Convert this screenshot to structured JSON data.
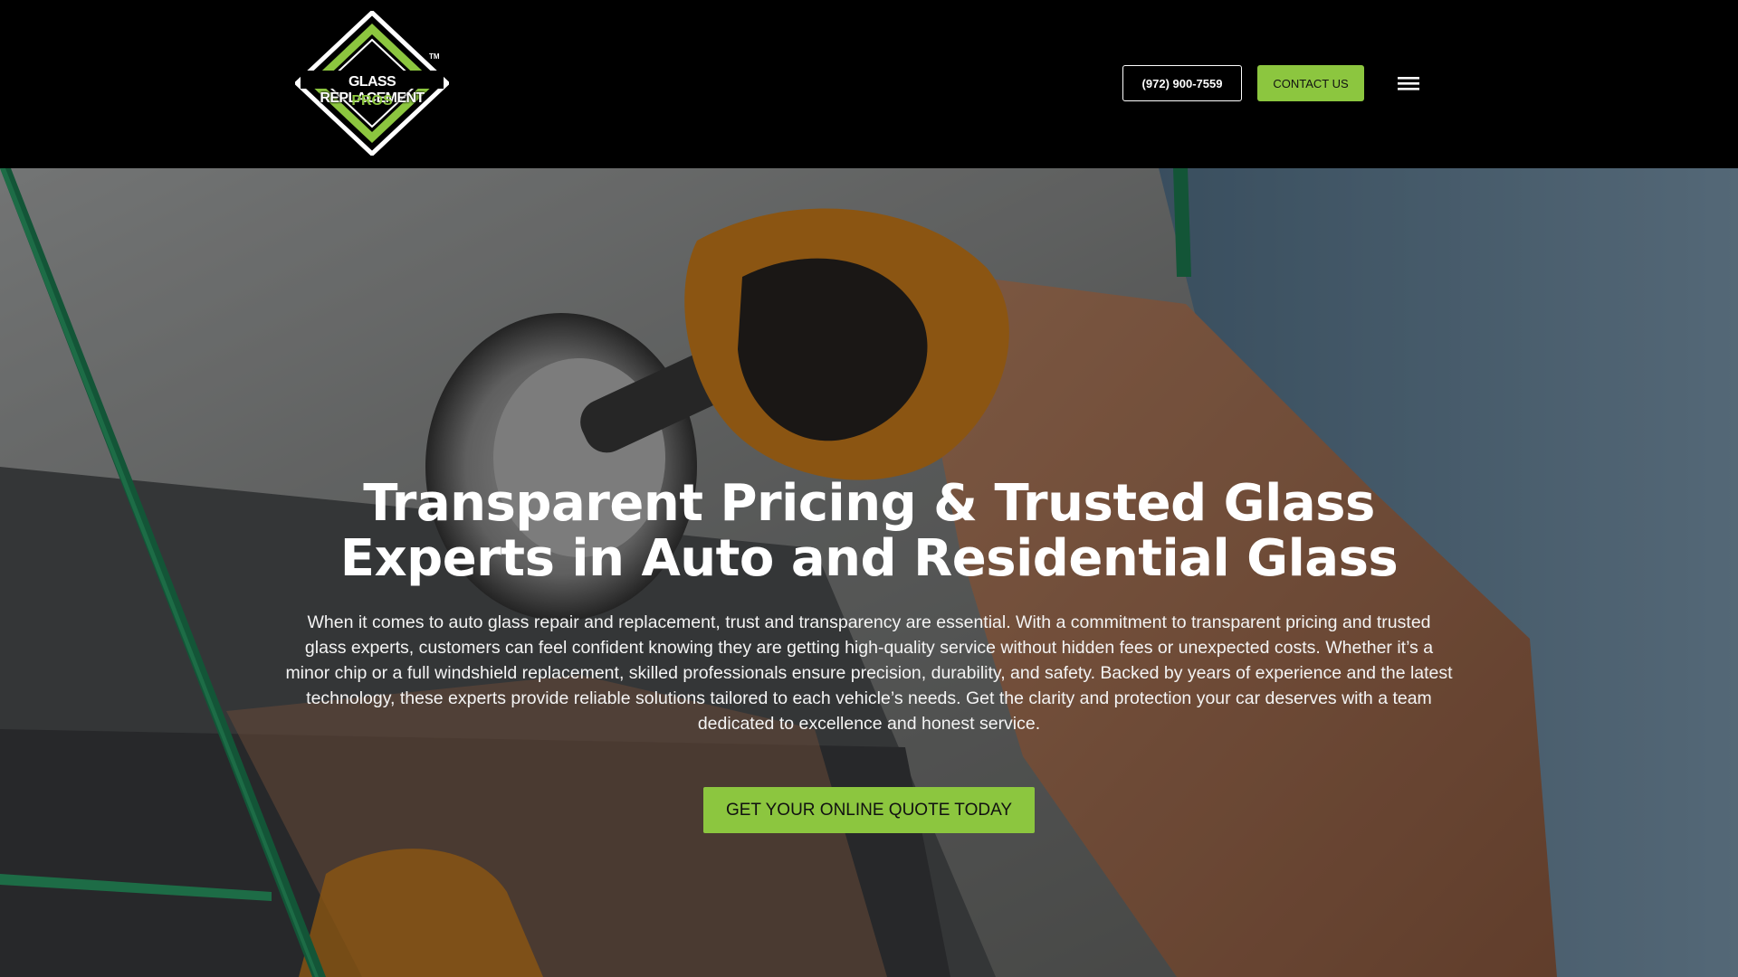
{
  "header": {
    "logo": {
      "line1": "GLASS REPLACEMENT",
      "line2": "PROS",
      "trademark": "TM",
      "colors": {
        "green": "#8cc63f",
        "white": "#ffffff",
        "black": "#000000"
      }
    },
    "phone_label": "(972) 900-7559",
    "contact_label": "CONTACT US",
    "menu_icon": "hamburger-menu-icon"
  },
  "hero": {
    "title": "Transparent Pricing & Trusted Glass Experts in Auto and Residential Glass",
    "description": "When it comes to auto glass repair and replacement, trust and transparency are essential. With a commitment to transparent pricing and trusted glass experts, customers can feel confident knowing they are getting high-quality service without hidden fees or unexpected costs. Whether it’s a minor chip or a full windshield replacement, skilled professionals ensure precision, durability, and safety. Backed by years of experience and the latest technology, these experts provide reliable solutions tailored to each vehicle’s needs. Get the clarity and protection your car deserves with a team dedicated to excellence and honest service.",
    "cta_label": "GET YOUR ONLINE QUOTE TODAY"
  },
  "colors": {
    "accent": "#8cc63f",
    "header_bg": "#000000",
    "text_light": "#ffffff"
  }
}
